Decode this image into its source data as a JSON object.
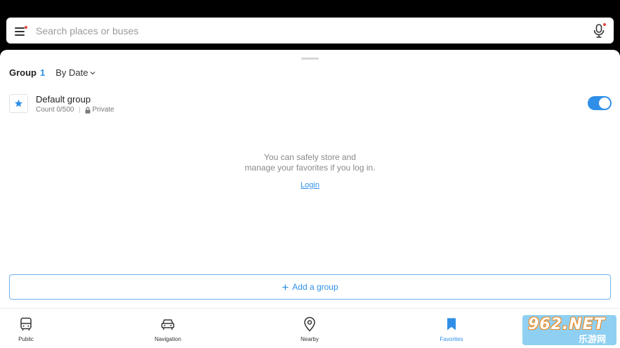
{
  "search": {
    "placeholder": "Search places or buses"
  },
  "favorites": {
    "group_label": "Group",
    "group_count": "1",
    "sort_label": "By Date",
    "group": {
      "name": "Default group",
      "count": "Count 0/500",
      "privacy": "Private",
      "enabled": true
    },
    "empty_line1": "You can safely store and",
    "empty_line2": "manage your favorites if you log in.",
    "login_label": "Login",
    "add_group_label": "Add a group"
  },
  "nav": {
    "items": [
      {
        "label": "Public",
        "icon": "bus-icon",
        "active": false
      },
      {
        "label": "Navigation",
        "icon": "car-icon",
        "active": false
      },
      {
        "label": "Nearby",
        "icon": "location-pin-icon",
        "active": false
      },
      {
        "label": "Favorites",
        "icon": "bookmark-icon",
        "active": true
      }
    ]
  },
  "watermark": {
    "top": "962.NET",
    "bottom": "乐游网"
  },
  "colors": {
    "accent": "#2f8fe8",
    "notification_dot": "#e8423f",
    "text_primary": "#222222",
    "text_muted": "#8a8a8a"
  }
}
